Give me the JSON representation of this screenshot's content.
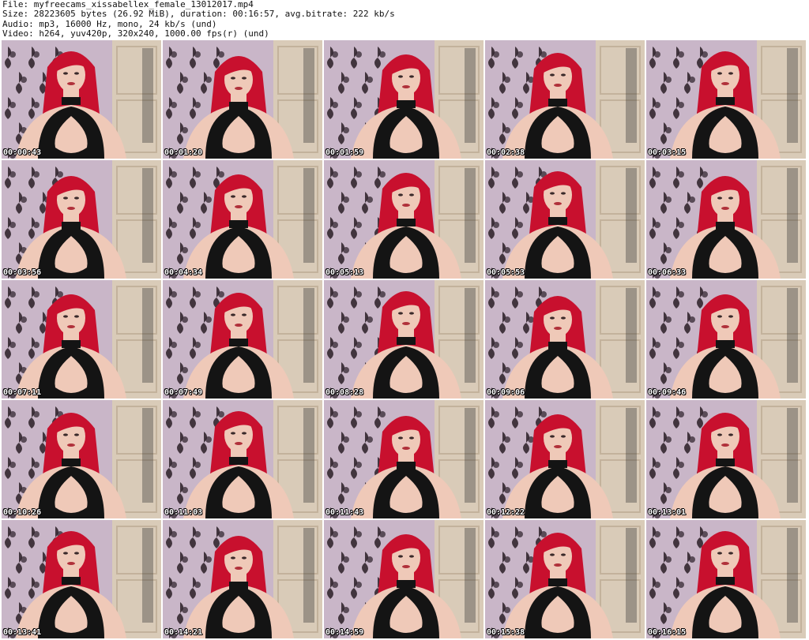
{
  "header": {
    "file_line": "File: myfreecams_xissabellex_female_13012017.mp4",
    "size_line": "Size: 28223605 bytes (26.92 MiB), duration: 00:16:57, avg.bitrate: 222 kb/s",
    "audio_line": "Audio: mp3, 16000 Hz, mono, 24 kb/s (und)",
    "video_line": "Video: h264, yuv420p, 320x240, 1000.00 fps(r) (und)"
  },
  "thumbnails": [
    {
      "timestamp": "00:00:43"
    },
    {
      "timestamp": "00:01:20"
    },
    {
      "timestamp": "00:01:59"
    },
    {
      "timestamp": "00:02:38"
    },
    {
      "timestamp": "00:03:15"
    },
    {
      "timestamp": "00:03:56"
    },
    {
      "timestamp": "00:04:34"
    },
    {
      "timestamp": "00:05:13"
    },
    {
      "timestamp": "00:05:53"
    },
    {
      "timestamp": "00:06:33"
    },
    {
      "timestamp": "00:07:11"
    },
    {
      "timestamp": "00:07:49"
    },
    {
      "timestamp": "00:08:28"
    },
    {
      "timestamp": "00:09:06"
    },
    {
      "timestamp": "00:09:46"
    },
    {
      "timestamp": "00:10:26"
    },
    {
      "timestamp": "00:11:03"
    },
    {
      "timestamp": "00:11:43"
    },
    {
      "timestamp": "00:12:22"
    },
    {
      "timestamp": "00:13:01"
    },
    {
      "timestamp": "00:13:41"
    },
    {
      "timestamp": "00:14:21"
    },
    {
      "timestamp": "00:14:59"
    },
    {
      "timestamp": "00:15:38"
    },
    {
      "timestamp": "00:16:15"
    }
  ],
  "colors": {
    "hair": "#c8102e",
    "skin": "#efc9b8",
    "top": "#141414",
    "wallpaper_light": "#c9b6c8",
    "wallpaper_dark": "#2a1e26",
    "door": "#d9cbb8"
  }
}
